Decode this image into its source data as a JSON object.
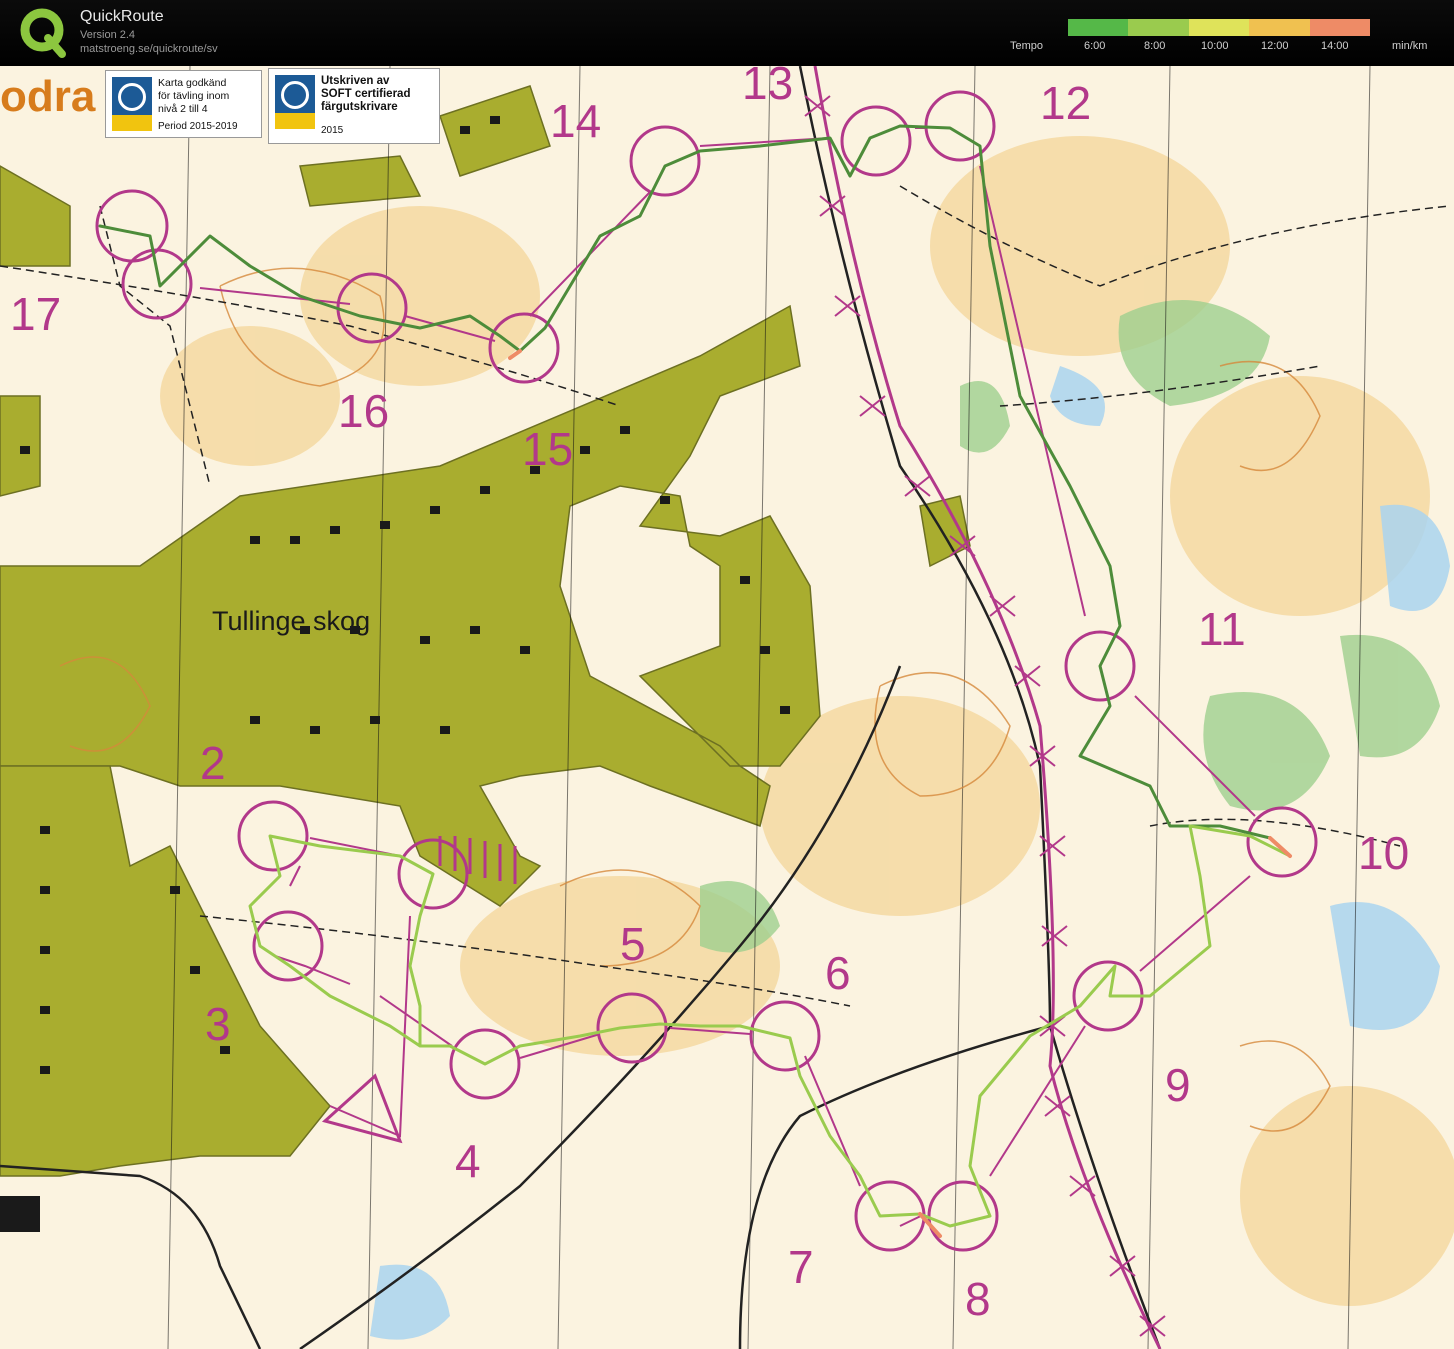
{
  "app": {
    "name": "QuickRoute",
    "version": "Version 2.4",
    "url": "matstroeng.se/quickroute/sv"
  },
  "legend": {
    "title": "Tempo",
    "ticks": [
      "6:00",
      "8:00",
      "10:00",
      "12:00",
      "14:00"
    ],
    "unit": "min/km",
    "colors": [
      "#55b848",
      "#9acb4e",
      "#dfe35a",
      "#f0c150",
      "#ee8b66"
    ]
  },
  "map": {
    "corner_title": "odra",
    "place_name": "Tullinge skog",
    "badges": [
      {
        "text": "Karta godkänd\nför tävling inom\nnivå 2 till 4",
        "sub": "Period 2015-2019"
      },
      {
        "text": "Utskriven av\nSOFT certifierad\nfärgutskrivare",
        "sub": "2015"
      }
    ],
    "control_numbers": [
      "2",
      "3",
      "4",
      "5",
      "6",
      "7",
      "8",
      "9",
      "10",
      "11",
      "12",
      "13",
      "14",
      "15",
      "16",
      "17"
    ],
    "colors": {
      "open_land": "#fbf3e0",
      "rough_open": "#f4d69a",
      "settlement": "#a9ad2f",
      "green_vegetation": "#9fd08e",
      "water": "#a9d3ef",
      "course": "#b2388a",
      "route": "#4d8c3a",
      "contour": "#d6883b",
      "road": "#222222"
    }
  }
}
